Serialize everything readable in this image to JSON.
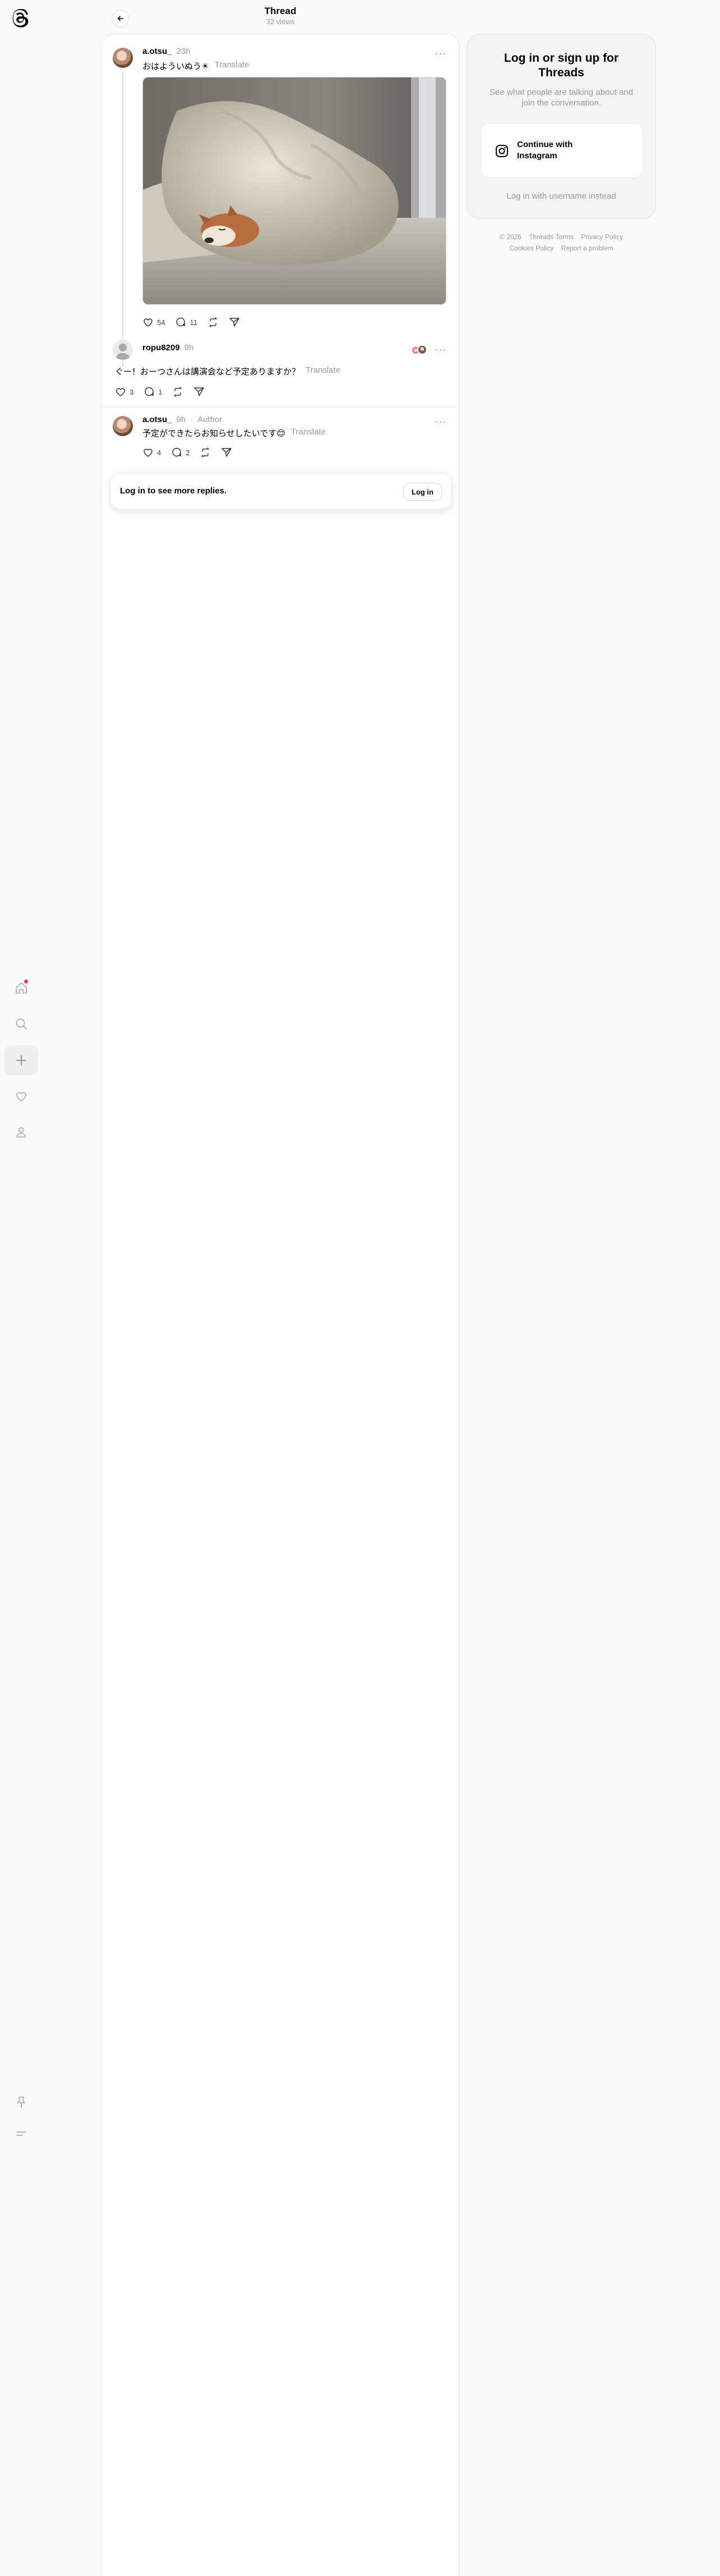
{
  "header": {
    "title": "Thread",
    "views": "32 views"
  },
  "main_post": {
    "username": "a.otsu_",
    "time": "23h",
    "text": "おはよういぬう☀︎",
    "translate": "Translate",
    "likes": "54",
    "replies": "11",
    "image_description": "Shiba dog sleeping under a blanket on a bed"
  },
  "reply_1": {
    "username": "ropu8209",
    "time": "9h",
    "text": "ぐー！おーつさんは講演会など予定ありますか？",
    "translate": "Translate",
    "likes": "3",
    "replies": "1"
  },
  "reply_2": {
    "username": "a.otsu_",
    "time": "9h",
    "author_label": "Author",
    "text": "予定ができたらお知らせしたいです😊",
    "translate": "Translate",
    "likes": "4",
    "replies": "2"
  },
  "login_prompt": {
    "text": "Log in to see more replies.",
    "button": "Log in"
  },
  "signup_panel": {
    "title": "Log in or sign up for Threads",
    "subtitle": "See what people are talking about and join the conversation.",
    "instagram_button": "Continue with Instagram",
    "alt_login": "Log in with username instead"
  },
  "footer": {
    "copyright": "© 2026",
    "links": [
      "Threads Terms",
      "Privacy Policy",
      "Cookies Policy",
      "Report a problem"
    ]
  },
  "colors": {
    "notification_dot": "#ff3040",
    "muted_text": "#999999"
  }
}
